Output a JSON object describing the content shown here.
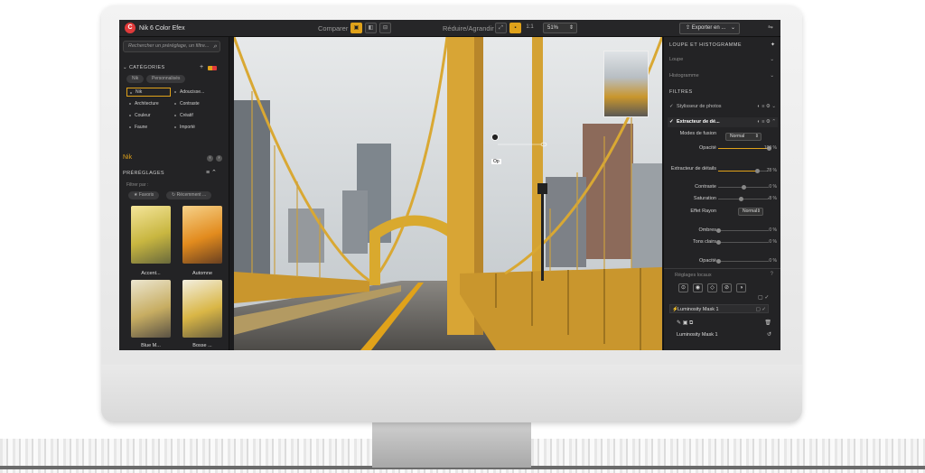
{
  "app": {
    "title": "Nik 6 Color Efex",
    "logo_letter": "C"
  },
  "toolbar": {
    "compare_label": "Comparer",
    "zoom_label": "Réduire/Agrandir",
    "zoom_ratio": "1:1",
    "zoom_value": "51%",
    "export_label": "Exporter en ...",
    "accent": "#e0a21a"
  },
  "left_panel": {
    "search_placeholder": "Rechercher un préréglage, un filtre...",
    "categories_title": "CATÉGORIES",
    "tabs": [
      "Nik",
      "Personnalisés"
    ],
    "categories": [
      [
        "Nik",
        "Adoucisse..."
      ],
      [
        "Architecture",
        "Contraste"
      ],
      [
        "Couleur",
        "Créatif"
      ],
      [
        "Faune",
        "Importé"
      ]
    ],
    "current_category": "Nik",
    "presets_title": "PRÉRÉGLAGES",
    "filter_by": "Filtrer par :",
    "filter_chips": [
      "Favoris",
      "Récemment ..."
    ],
    "presets": [
      "Accent...",
      "Automne",
      "Blue M...",
      "Bosse ..."
    ]
  },
  "right_panel": {
    "loupe_section": "LOUPE ET HISTOGRAMME",
    "loupe": "Loupe",
    "histogram": "Histogramme",
    "filters_section": "FILTRES",
    "filter1": "Stylisseur de photos",
    "filter2": "Extracteur de dé...",
    "blend_mode_label": "Modes de fusion",
    "blend_mode_value": "Normal",
    "opacity_label": "Opacité",
    "opacity_value": "100 %",
    "detail_label": "Extracteur de détails",
    "detail_value": "78 %",
    "contrast_label": "Contraste",
    "contrast_value": "0 %",
    "saturation_label": "Saturation",
    "saturation_value": "-8 %",
    "effect_label": "Effet Rayon",
    "effect_value": "Normal",
    "shadows_label": "Ombres",
    "shadows_value": "0 %",
    "highlights_label": "Tons clairs",
    "highlights_value": "0 %",
    "opacity2_label": "Opacité",
    "opacity2_value": "0 %",
    "local_adjust": "Réglages locaux",
    "mask_name": "Luminosity Mask 1",
    "mask_label": "Luminosity Mask 1",
    "slider_levels": {
      "opacity": 100,
      "detail": 78,
      "contrast": 0,
      "saturation": -8,
      "shadows": 0,
      "highlights": 0,
      "opacity2": 0
    }
  },
  "canvas": {
    "control_point_label": "Op"
  }
}
